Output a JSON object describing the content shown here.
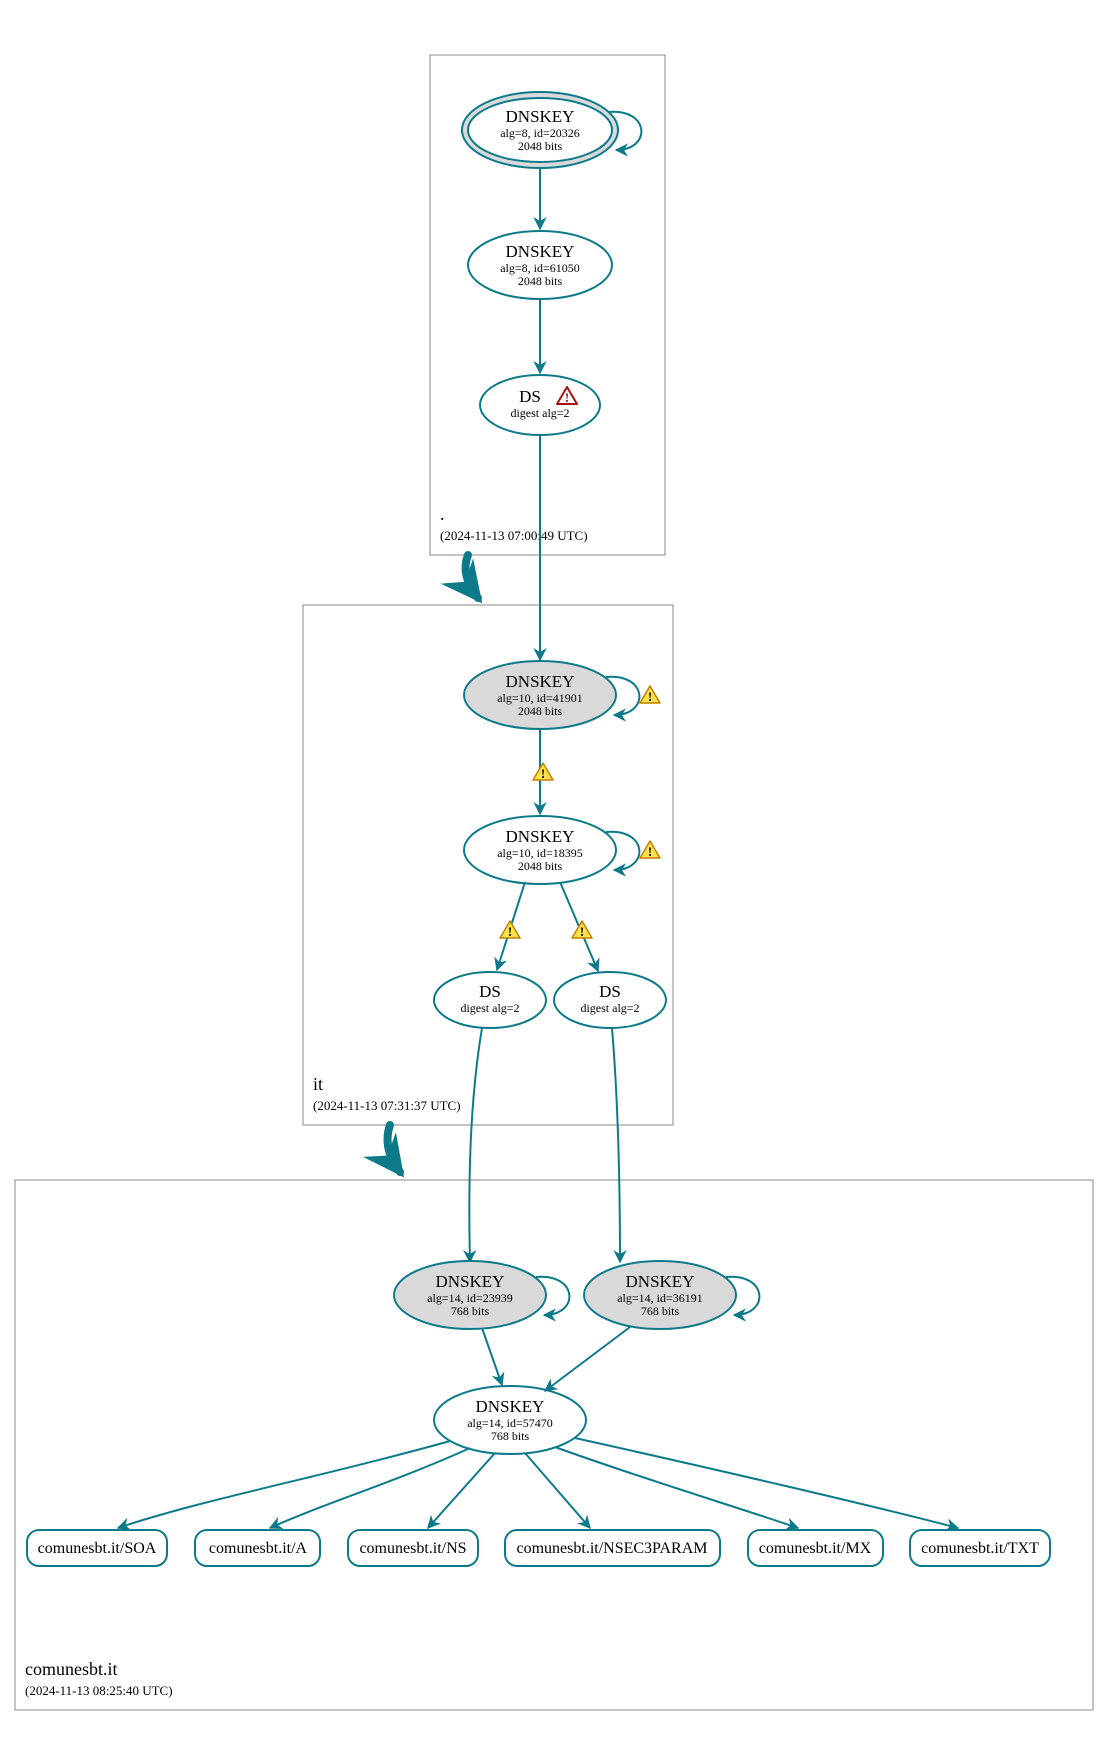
{
  "colors": {
    "teal": "#0d7a8a",
    "grayFill": "#d9d9d9",
    "boxStroke": "#888888"
  },
  "zones": {
    "root": {
      "name": ".",
      "timestamp": "(2024-11-13 07:00:49 UTC)"
    },
    "it": {
      "name": "it",
      "timestamp": "(2024-11-13 07:31:37 UTC)"
    },
    "leaf": {
      "name": "comunesbt.it",
      "timestamp": "(2024-11-13 08:25:40 UTC)"
    }
  },
  "nodes": {
    "rootKSK": {
      "title": "DNSKEY",
      "line2": "alg=8, id=20326",
      "line3": "2048 bits"
    },
    "rootZSK": {
      "title": "DNSKEY",
      "line2": "alg=8, id=61050",
      "line3": "2048 bits"
    },
    "rootDS": {
      "title": "DS",
      "line2": "digest alg=2"
    },
    "itKSK": {
      "title": "DNSKEY",
      "line2": "alg=10, id=41901",
      "line3": "2048 bits"
    },
    "itZSK": {
      "title": "DNSKEY",
      "line2": "alg=10, id=18395",
      "line3": "2048 bits"
    },
    "itDS1": {
      "title": "DS",
      "line2": "digest alg=2"
    },
    "itDS2": {
      "title": "DS",
      "line2": "digest alg=2"
    },
    "leafKSK1": {
      "title": "DNSKEY",
      "line2": "alg=14, id=23939",
      "line3": "768 bits"
    },
    "leafKSK2": {
      "title": "DNSKEY",
      "line2": "alg=14, id=36191",
      "line3": "768 bits"
    },
    "leafZSK": {
      "title": "DNSKEY",
      "line2": "alg=14, id=57470",
      "line3": "768 bits"
    }
  },
  "rrsets": {
    "soa": "comunesbt.it/SOA",
    "a": "comunesbt.it/A",
    "ns": "comunesbt.it/NS",
    "nsec3": "comunesbt.it/NSEC3PARAM",
    "mx": "comunesbt.it/MX",
    "txt": "comunesbt.it/TXT"
  }
}
